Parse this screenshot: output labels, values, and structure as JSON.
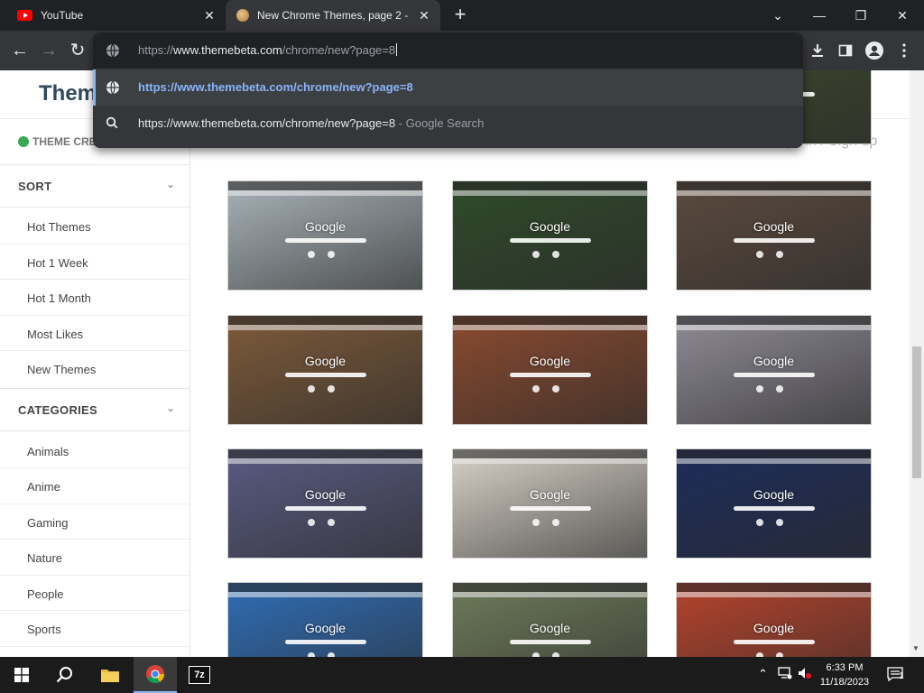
{
  "tabs": [
    {
      "title": "YouTube",
      "icon": "youtube-icon"
    },
    {
      "title": "New Chrome Themes, page 2 - T",
      "icon": "themebeta-icon",
      "active": true
    }
  ],
  "omnibox": {
    "input_url_prefix": "https://",
    "input_url_host": "www.themebeta.com",
    "input_url_path": "/chrome/new?page=8",
    "suggestions": [
      {
        "text": "https://www.themebeta.com/chrome/new?page=8",
        "icon": "globe-icon"
      },
      {
        "text": "https://www.themebeta.com/chrome/new?page=8",
        "sub": " - Google Search",
        "icon": "search-icon"
      }
    ]
  },
  "site": {
    "logo": "Them",
    "theme_creator": "THEME CREATOR",
    "signin": "gn in / Sign up"
  },
  "sidebar": {
    "sort_heading": "SORT",
    "sort_items": [
      "Hot Themes",
      "Hot 1 Week",
      "Hot 1 Month",
      "Most Likes",
      "New Themes"
    ],
    "categories_heading": "CATEGORIES",
    "category_items": [
      "Animals",
      "Anime",
      "Gaming",
      "Nature",
      "People",
      "Sports"
    ]
  },
  "thumbnails": {
    "google_label": "Google",
    "rows": [
      [
        {
          "bg": "#7a6a5c"
        },
        {
          "bg": "#6f8a4a"
        },
        {
          "bg": "#3f4a2c"
        }
      ],
      [
        {
          "bg": "#a9b3b8"
        },
        {
          "bg": "#2f4a2a"
        },
        {
          "bg": "#5b4a3e"
        }
      ],
      [
        {
          "bg": "#7d5a3a"
        },
        {
          "bg": "#8a4a2f"
        },
        {
          "bg": "#8f8b96"
        }
      ],
      [
        {
          "bg": "#5a5b82"
        },
        {
          "bg": "#d8d2c8"
        },
        {
          "bg": "#1d2c5a"
        }
      ],
      [
        {
          "bg": "#2f6db5"
        },
        {
          "bg": "#6e7a5a"
        },
        {
          "bg": "#b5432c"
        }
      ]
    ]
  },
  "taskbar": {
    "time": "6:33 PM",
    "date": "11/18/2023",
    "notification_count": "1",
    "apps": [
      "start-icon",
      "search-icon",
      "file-explorer-icon",
      "chrome-icon",
      "7zip-icon"
    ],
    "zip_label": "7z"
  },
  "colors": {
    "tab_bg": "#202124",
    "toolbar_bg": "#35363a",
    "link_blue": "#8ab4f8"
  }
}
